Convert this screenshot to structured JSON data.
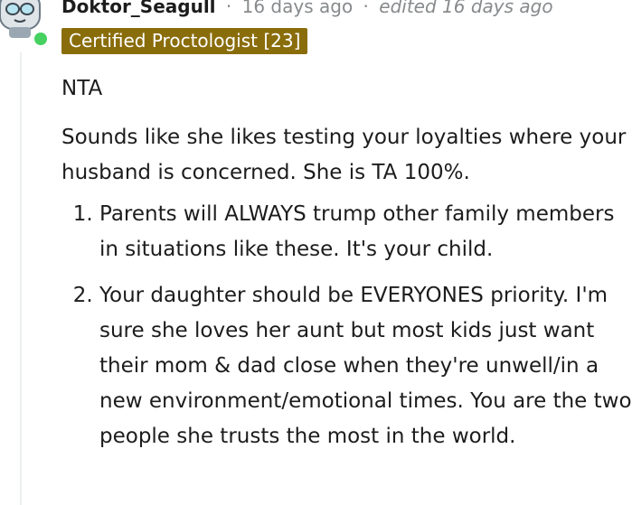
{
  "comment": {
    "username": "Doktor_Seagull",
    "separator": "·",
    "time": "16 days ago",
    "edited": "edited 16 days ago",
    "flair": "Certified Proctologist [23]",
    "online": true,
    "colors": {
      "flair_bg": "#8a6d0b",
      "online_dot": "#46d160",
      "meta_text": "#878a8c"
    },
    "avatar_icon": "robot-seagull-avatar-icon",
    "body": {
      "paragraphs": [
        "NTA",
        "Sounds like she likes testing your loyalties where your husband is concerned. She is TA 100%."
      ],
      "list": [
        "Parents will ALWAYS trump other family members in situations like these. It's your child.",
        "Your daughter should be EVERYONES priority. I'm sure she loves her aunt but most kids just want their mom & dad close when they're unwell/in a new environment/emotional times. You are the two people she trusts the most in the world."
      ]
    }
  }
}
